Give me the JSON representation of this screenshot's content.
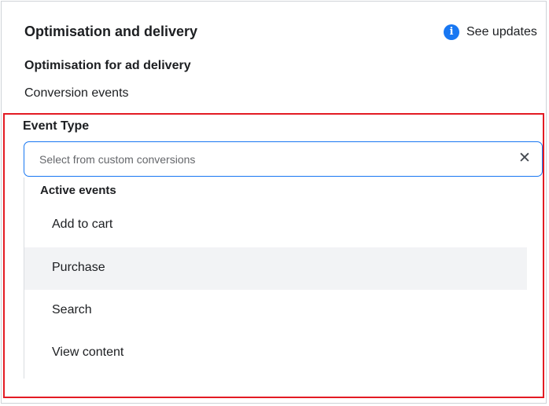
{
  "section": {
    "title": "Optimisation and delivery",
    "notice_text": "See updates",
    "notice_icon": "info-icon",
    "accent_color": "#1877f2"
  },
  "optimisation": {
    "heading": "Optimisation for ad delivery",
    "value": "Conversion events"
  },
  "event_type": {
    "label": "Event Type",
    "search_placeholder": "Select from custom conversions",
    "search_value": "",
    "clear_icon": "close-icon"
  },
  "dropdown": {
    "group_label": "Active events",
    "options": [
      {
        "label": "Add to cart",
        "hovered": false
      },
      {
        "label": "Purchase",
        "hovered": true
      },
      {
        "label": "Search",
        "hovered": false
      },
      {
        "label": "View content",
        "hovered": false
      }
    ]
  },
  "highlight_color": "#e31b23"
}
